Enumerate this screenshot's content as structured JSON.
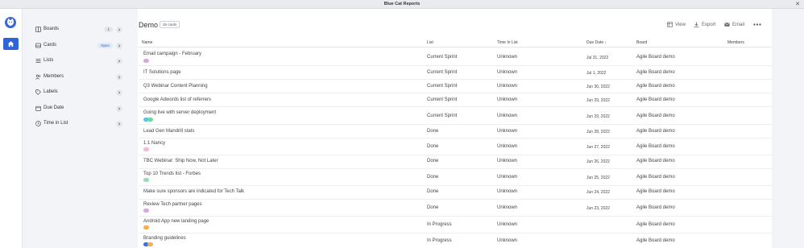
{
  "window": {
    "title": "Blue Cat Reports",
    "close": "✕"
  },
  "rail": {
    "logo": "cat-logo",
    "home": "home-icon"
  },
  "sidebar": {
    "items": [
      {
        "label": "Boards",
        "icon": "boards-icon",
        "badge": "1",
        "badge_style": "gray"
      },
      {
        "label": "Cards",
        "icon": "cards-icon",
        "badge": "Open",
        "badge_style": "blue"
      },
      {
        "label": "Lists",
        "icon": "lists-icon",
        "badge": ""
      },
      {
        "label": "Members",
        "icon": "members-icon",
        "badge": ""
      },
      {
        "label": "Labels",
        "icon": "labels-icon",
        "badge": ""
      },
      {
        "label": "Due Date",
        "icon": "calendar-icon",
        "badge": ""
      },
      {
        "label": "Time in List",
        "icon": "clock-icon",
        "badge": ""
      }
    ]
  },
  "main": {
    "title": "Demo",
    "count": "26 cards",
    "actions": {
      "view": "View",
      "export": "Export",
      "email": "Email"
    }
  },
  "table": {
    "columns": {
      "name": "Name",
      "list": "List",
      "time": "Time In List",
      "due": "Due Date",
      "due_sort": "↓",
      "board": "Board",
      "members": "Members"
    },
    "rows": [
      {
        "name": "Email campaign - February",
        "list": "Current Sprint",
        "time": "Unknown",
        "due": "Jul 31, 2022",
        "board": "Agile Board demo",
        "labels": [
          "#d9a6e6"
        ]
      },
      {
        "name": "IT Solutions page",
        "list": "Current Sprint",
        "time": "Unknown",
        "due": "Jul 1, 2022",
        "board": "Agile Board demo",
        "labels": []
      },
      {
        "name": "Q3 Webinar Content Planning",
        "list": "Current Sprint",
        "time": "Unknown",
        "due": "Jun 30, 2022",
        "board": "Agile Board demo",
        "labels": []
      },
      {
        "name": "Google Adwords list of referrers",
        "list": "Current Sprint",
        "time": "Unknown",
        "due": "Jun 29, 2022",
        "board": "Agile Board demo",
        "labels": []
      },
      {
        "name": "Going live with server deployment",
        "list": "Current Sprint",
        "time": "Unknown",
        "due": "Jun 29, 2022",
        "board": "Agile Board demo",
        "labels": [
          "#5ec4e0",
          "#6fd6a8"
        ]
      },
      {
        "name": "Lead Gen Mandrill stats",
        "list": "Done",
        "time": "Unknown",
        "due": "Jun 28, 2022",
        "board": "Agile Board demo",
        "labels": []
      },
      {
        "name": "1:1 Nancy",
        "list": "Done",
        "time": "Unknown",
        "due": "Jun 27, 2022",
        "board": "Agile Board demo",
        "labels": [
          "#f4b8d4"
        ]
      },
      {
        "name": "TBC Webinar: Ship Now, Not Later",
        "list": "Done",
        "time": "Unknown",
        "due": "Jun 26, 2022",
        "board": "Agile Board demo",
        "labels": []
      },
      {
        "name": "Top 10 Trends list - Forbes",
        "list": "Done",
        "time": "Unknown",
        "due": "Jun 25, 2022",
        "board": "Agile Board demo",
        "labels": [
          "#8fe0b6"
        ]
      },
      {
        "name": "Make sure sponsors are indicated for Tech Talk",
        "list": "Done",
        "time": "Unknown",
        "due": "Jun 24, 2022",
        "board": "Agile Board demo",
        "labels": []
      },
      {
        "name": "Review Tech partner pages",
        "list": "Done",
        "time": "Unknown",
        "due": "Jun 23, 2022",
        "board": "Agile Board demo",
        "labels": [
          "#d9a6e6"
        ]
      },
      {
        "name": "Android App new landing page",
        "list": "In Progress",
        "time": "Unknown",
        "due": "",
        "board": "Agile Board demo",
        "labels": [
          "#f2b04e"
        ]
      },
      {
        "name": "Branding guidelines",
        "list": "In Progress",
        "time": "Unknown",
        "due": "",
        "board": "Agile Board demo",
        "labels": [
          "#3f6fd8",
          "#f2b04e"
        ]
      }
    ]
  }
}
